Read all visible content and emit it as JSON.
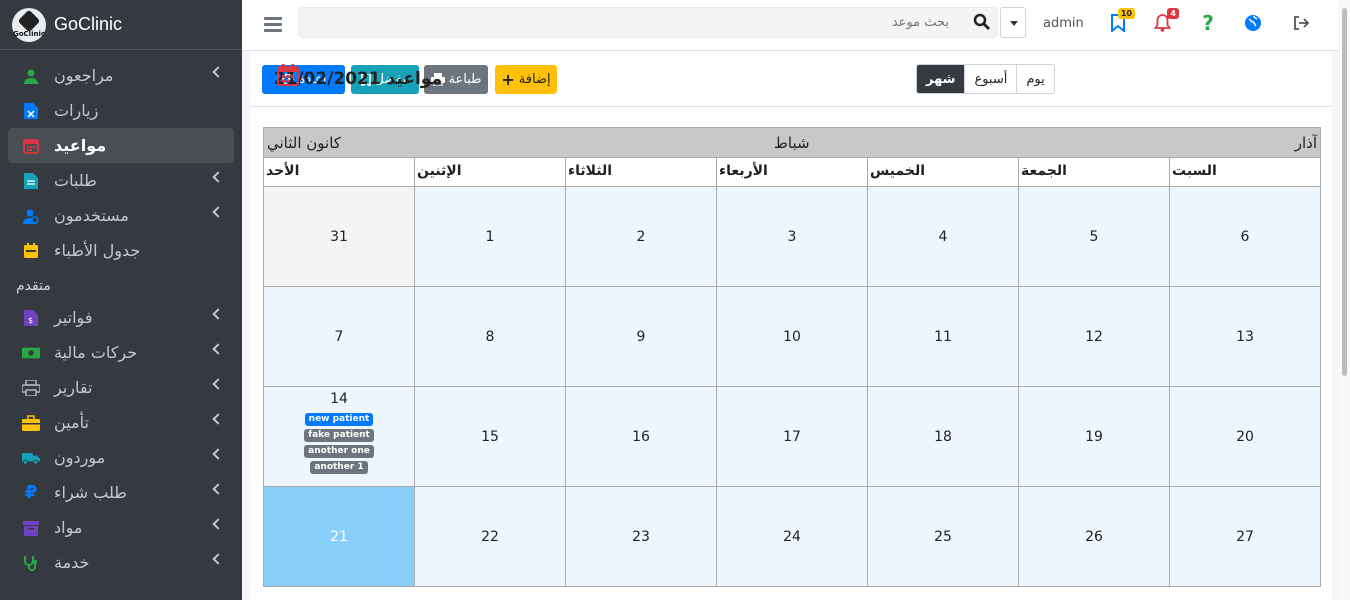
{
  "brand": {
    "name": "GoClinic",
    "logo_text": "GoClinic"
  },
  "sidebar": {
    "items": [
      {
        "label": "مراجعون",
        "icon": "user-icon",
        "color": "#28a745",
        "chevron": true,
        "active": false
      },
      {
        "label": "زيارات",
        "icon": "file-x-icon",
        "color": "#007bff",
        "chevron": false,
        "active": false
      },
      {
        "label": "مواعيد",
        "icon": "calendar-icon",
        "color": "#dc3545",
        "chevron": false,
        "active": true
      },
      {
        "label": "طلبات",
        "icon": "document-icon",
        "color": "#17a2b8",
        "chevron": true,
        "active": false
      },
      {
        "label": "مستخدمون",
        "icon": "user-gear-icon",
        "color": "#007bff",
        "chevron": true,
        "active": false
      },
      {
        "label": "جدول الأطباء",
        "icon": "schedule-icon",
        "color": "#ffc107",
        "chevron": false,
        "active": false
      }
    ],
    "section_header": "متقدم",
    "advanced_items": [
      {
        "label": "فواتير",
        "icon": "invoice-icon",
        "color": "#6f42c1",
        "chevron": true
      },
      {
        "label": "حركات مالية",
        "icon": "money-icon",
        "color": "#28a745",
        "chevron": true
      },
      {
        "label": "تقارير",
        "icon": "printer-icon",
        "color": "#adb5bd",
        "chevron": true
      },
      {
        "label": "تأمين",
        "icon": "briefcase-icon",
        "color": "#ffc107",
        "chevron": true
      },
      {
        "label": "موردون",
        "icon": "truck-icon",
        "color": "#17a2b8",
        "chevron": true
      },
      {
        "label": "طلب شراء",
        "icon": "ruble-icon",
        "color": "#007bff",
        "chevron": true
      },
      {
        "label": "مواد",
        "icon": "archive-icon",
        "color": "#6f42c1",
        "chevron": true
      },
      {
        "label": "خدمة",
        "icon": "stethoscope-icon",
        "color": "#28a745",
        "chevron": true
      }
    ]
  },
  "header": {
    "search_placeholder": "بحث موعد",
    "user": "admin",
    "bookmark_badge": "10",
    "bell_badge": "4"
  },
  "page": {
    "title": "مواعيد 21/02/2021",
    "buttons": {
      "refresh": "اعادة",
      "favorite": "مفضل",
      "print": "طباعة",
      "add": "إضافة"
    },
    "views": {
      "day": "يوم",
      "week": "أسبوع",
      "month": "شهر"
    }
  },
  "calendar": {
    "prev_month": "كانون الثاني",
    "current_month": "شباط",
    "next_month": "آذار",
    "days": [
      "الأحد",
      "الإثنين",
      "الثلاثاء",
      "الأربعاء",
      "الخميس",
      "الجمعة",
      "السبت"
    ],
    "weeks": [
      [
        "31",
        "1",
        "2",
        "3",
        "4",
        "5",
        "6"
      ],
      [
        "7",
        "8",
        "9",
        "10",
        "11",
        "12",
        "13"
      ],
      [
        "14",
        "15",
        "16",
        "17",
        "18",
        "19",
        "20"
      ],
      [
        "21",
        "22",
        "23",
        "24",
        "25",
        "26",
        "27"
      ]
    ],
    "events_day_14": [
      {
        "label": "new patient",
        "color": "#007bff"
      },
      {
        "label": "fake patient",
        "color": "#6c757d"
      },
      {
        "label": "another one",
        "color": "#6c757d"
      },
      {
        "label": "another 1",
        "color": "#6c757d"
      }
    ]
  },
  "colors": {
    "refresh": "#007bff",
    "favorite": "#17a2b8",
    "print": "#6c757d",
    "add": "#ffc107",
    "today": "#87cefa"
  }
}
